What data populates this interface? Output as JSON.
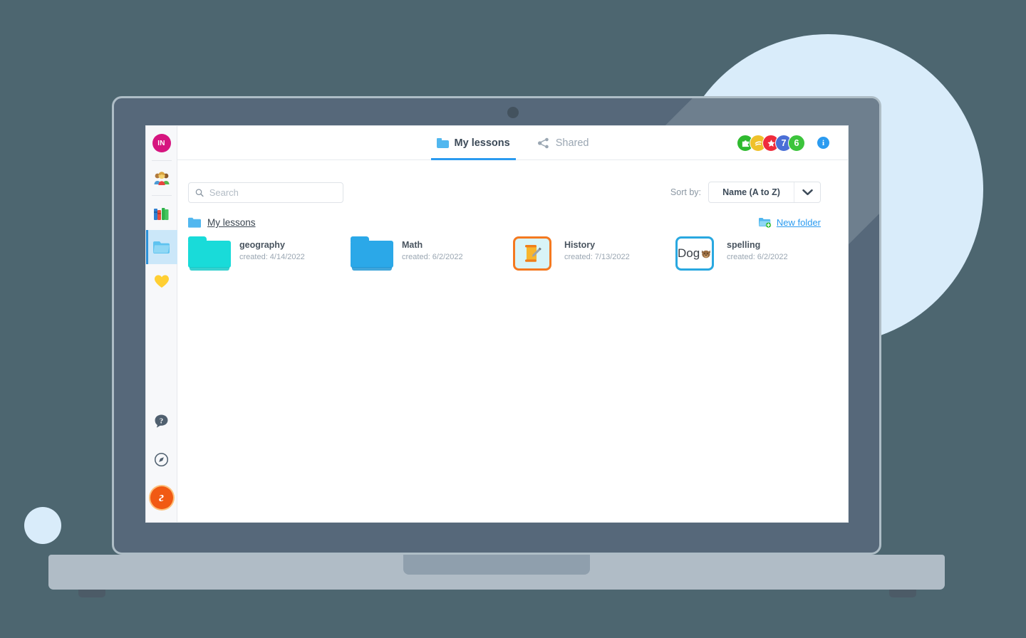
{
  "theme": {
    "page_bg": "#4d6670",
    "accent_blue": "#2b9bf0",
    "decor_circle": "#d9ecfa",
    "laptop_lid": "#56687a",
    "laptop_base": "#b0bcc6"
  },
  "sidebar": {
    "avatar_initials": "IN",
    "items": [
      {
        "id": "avatar",
        "name": "user-avatar",
        "icon": "avatar-initials",
        "active": false
      },
      {
        "id": "students",
        "name": "sidebar-item-students",
        "icon": "students-icon",
        "active": false
      },
      {
        "id": "library",
        "name": "sidebar-item-library",
        "icon": "books-icon",
        "active": false
      },
      {
        "id": "lessons",
        "name": "sidebar-item-my-lessons",
        "icon": "folder-icon",
        "active": true
      },
      {
        "id": "favorites",
        "name": "sidebar-item-favorites",
        "icon": "heart-icon",
        "active": false
      }
    ],
    "bottom_items": [
      {
        "id": "help",
        "name": "sidebar-item-help",
        "icon": "help-bubble-icon"
      },
      {
        "id": "explore",
        "name": "sidebar-item-explore",
        "icon": "compass-icon"
      },
      {
        "id": "logo",
        "name": "app-logo",
        "icon": "brand-logo-icon",
        "glyph": "г"
      }
    ]
  },
  "topbar": {
    "tabs": [
      {
        "id": "my-lessons",
        "label": "My lessons",
        "icon": "folder-icon",
        "active": true
      },
      {
        "id": "shared",
        "label": "Shared",
        "icon": "share-icon",
        "active": false
      }
    ],
    "badges": [
      {
        "id": "badge-puzzle",
        "icon": "puzzle-piece-icon",
        "label": "",
        "color": "#2fba2f"
      },
      {
        "id": "badge-hand",
        "icon": "hand-icon",
        "label": "",
        "color": "#efc12a"
      },
      {
        "id": "badge-star",
        "icon": "star-icon",
        "label": "",
        "color": "#ef2b3c"
      },
      {
        "id": "badge-seven",
        "icon": "number-badge",
        "label": "7",
        "color": "#4a6fd6"
      },
      {
        "id": "badge-six",
        "icon": "number-badge",
        "label": "6",
        "color": "#3cc43c"
      }
    ],
    "info_icon_label": "i"
  },
  "toolbar": {
    "search_placeholder": "Search",
    "search_value": "",
    "sort_label": "Sort by:",
    "sort_value": "Name (A to Z)",
    "sort_options": [
      "Name (A to Z)"
    ]
  },
  "breadcrumb": {
    "label": "My lessons",
    "icon": "folder-icon"
  },
  "new_folder": {
    "label": "New folder",
    "icon": "new-folder-icon"
  },
  "items": [
    {
      "name": "geography",
      "date": "created: 4/14/2022",
      "thumb_type": "folder",
      "color": "#19dbd9",
      "thumb_name": "folder-thumb-geography"
    },
    {
      "name": "Math",
      "date": "created: 6/2/2022",
      "thumb_type": "folder",
      "color": "#2ba8e8",
      "thumb_name": "folder-thumb-math"
    },
    {
      "name": "History",
      "date": "created: 7/13/2022",
      "thumb_type": "card",
      "border": "#f47920",
      "bg": "#d8f4f7",
      "glyph": "scroll-pencil-icon",
      "thumb_name": "lesson-thumb-history"
    },
    {
      "name": "spelling",
      "date": "created: 6/2/2022",
      "thumb_type": "card-text",
      "border": "#29a8e8",
      "bg": "#ffffff",
      "text": "Dog",
      "glyph": "dog-face-icon",
      "thumb_name": "lesson-thumb-spelling"
    }
  ]
}
